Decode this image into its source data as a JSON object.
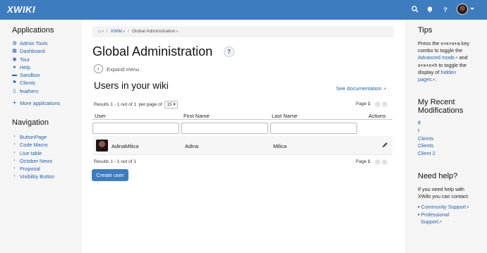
{
  "topbar": {
    "logo": "XWIKI",
    "icons": [
      "search-icon",
      "bell-icon",
      "help-icon",
      "user-avatar"
    ]
  },
  "left": {
    "applications_title": "Applications",
    "apps": [
      {
        "label": "Admin Tools",
        "icon": "globe-icon"
      },
      {
        "label": "Dashboard",
        "icon": "dashboard-icon"
      },
      {
        "label": "Tour",
        "icon": "tour-icon"
      },
      {
        "label": "Help",
        "icon": "help-icon"
      },
      {
        "label": "Sandbox",
        "icon": "sandbox-icon"
      },
      {
        "label": "Clients",
        "icon": "flag-icon"
      },
      {
        "label": "feathers",
        "icon": "page-icon"
      }
    ],
    "more_apps": "More applications",
    "navigation_title": "Navigation",
    "nav": [
      "ButtonPage",
      "Code Macro",
      "Live table",
      "October News",
      "Proposal",
      "Visibility Button"
    ]
  },
  "breadcrumb": {
    "home_icon": "home-icon",
    "items": [
      "XWiki",
      "Global Administration"
    ]
  },
  "main": {
    "title": "Global Administration",
    "help_label": "?",
    "expand_label": "Expand menu",
    "section_title": "Users in your wiki",
    "doc_link": "See documentation",
    "results_top": "Results 1 - 1 out of 1",
    "per_page_label": "per page of",
    "per_page_value": "15",
    "page_label": "Page",
    "page_num": "1",
    "results_bottom": "Results 1 - 1 out of 1",
    "create_user": "Create user"
  },
  "table": {
    "columns": [
      "User",
      "First Name",
      "Last Name",
      "Actions"
    ],
    "rows": [
      {
        "user": "AdinaMilica",
        "first": "Adina",
        "last": "Milica"
      }
    ]
  },
  "right": {
    "tips_title": "Tips",
    "tips_line1": "Press the x+x+x+a key",
    "tips_line2": "combo to toggle the",
    "tips_link1": "Advanced mode",
    "tips_line3_suffix": " and",
    "tips_line4": "x+x+x+h to toggle the",
    "tips_line5": "display of",
    "tips_link2_a": "hidden",
    "tips_link2_b": "pages",
    "tips_end": ".",
    "recent_title_1": "My Recent",
    "recent_title_2": "Modifications",
    "recent": [
      "ff",
      "f",
      "Cleints",
      "Clients",
      "Client 2"
    ],
    "help_title": "Need help?",
    "help_line1": "If you need help with",
    "help_line2": "XWiki you can contact:",
    "help_links": [
      "Community Support",
      "Professional",
      "Support"
    ]
  },
  "colors": {
    "accent": "#3e7cc0",
    "link": "#2763a9"
  }
}
